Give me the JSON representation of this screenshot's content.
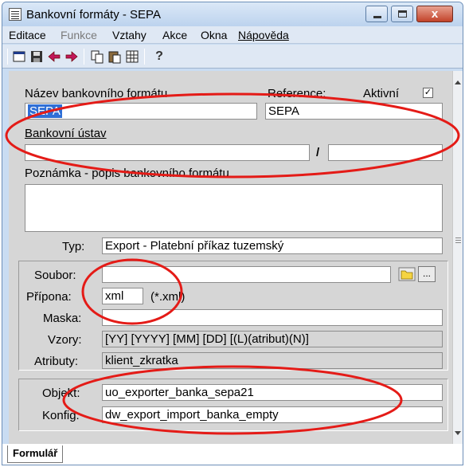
{
  "window": {
    "title": "Bankovní formáty - SEPA",
    "close_label": "x"
  },
  "menu": {
    "editace": "Editace",
    "funkce": "Funkce",
    "vztahy": "Vztahy",
    "akce": "Akce",
    "okna": "Okna",
    "napoveda": "Nápověda"
  },
  "toolbar": {
    "help": "?"
  },
  "form": {
    "nazev_label": "Název bankovního formátu",
    "nazev_value": "SEPA",
    "reference_label": "Reference:",
    "reference_value": "SEPA",
    "aktivni_label": "Aktivní",
    "aktivni_checked": "☑",
    "ustav_label": "Bankovní ústav",
    "ustav_value1": "",
    "ustav_slash": "/",
    "ustav_value2": "",
    "poznamka_label": "Poznámka - popis bankovního formátu",
    "poznamka_value": "",
    "typ_label": "Typ:",
    "typ_value": "Export - Platební příkaz tuzemský",
    "soubor_label": "Soubor:",
    "soubor_value": "",
    "browse_label": "...",
    "pripona_label": "Přípona:",
    "pripona_value": "xml",
    "pripona_hint": "(*.xml)",
    "maska_label": "Maska:",
    "maska_value": "",
    "vzory_label": "Vzory:",
    "vzory_value": "[YY] [YYYY] [MM] [DD] [(L)(atribut)(N)]",
    "atributy_label": "Atributy:",
    "atributy_value": "klient_zkratka",
    "objekt_label": "Objekt:",
    "objekt_value": "uo_exporter_banka_sepa21",
    "konfig_label": "Konfig:",
    "konfig_value": "dw_export_import_banka_empty"
  },
  "tabs": {
    "formular": "Formulář"
  },
  "annotation_color": "#e41b17"
}
